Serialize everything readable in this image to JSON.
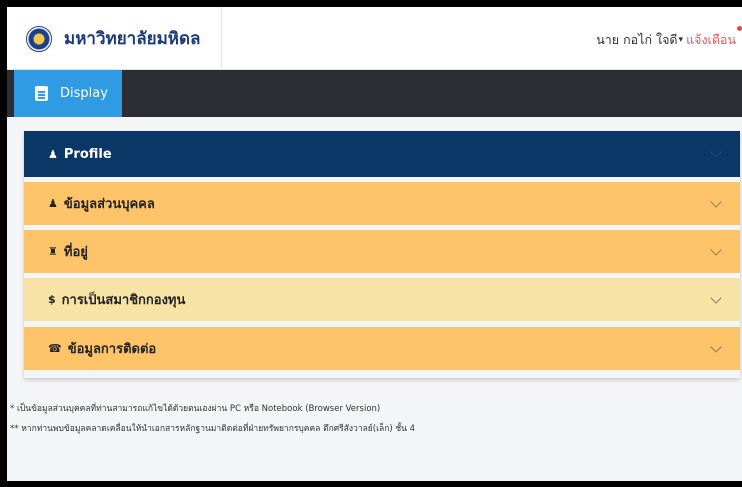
{
  "brand": {
    "name": "มหาวิทยาลัยมหิดล",
    "logo_icon": "university-seal-icon"
  },
  "user": {
    "name": "นาย กอไก่ ใจดี",
    "caret": "▾",
    "notifications_label": "แจ้งเตือน"
  },
  "nav": {
    "tab_label": "Display",
    "tab_icon": "clipboard-icon"
  },
  "accordion": {
    "header": {
      "icon": "♟",
      "label": "Profile"
    },
    "items": [
      {
        "icon": "♟",
        "label": "ข้อมูลส่วนบุคคล",
        "color": "#fec46a"
      },
      {
        "icon": "♜",
        "label": "ที่อยู่",
        "color": "#fec46a"
      },
      {
        "icon": "$",
        "label": "การเป็นสมาชิกกองทุน",
        "color": "#f7e3a6"
      },
      {
        "icon": "☎",
        "label": "ข้อมูลการติดต่อ",
        "color": "#fec46a"
      }
    ]
  },
  "notes": [
    "* เป็นข้อมูลส่วนบุคคลที่ท่านสามารถแก้ไขได้ด้วยตนเองผ่าน PC หรือ Notebook (Browser Version)",
    "** หากท่านพบข้อมูลคลาดเคลื่อนให้นำเอกสารหลักฐานมาติดต่อที่ฝ่ายทรัพยากรบุคคล ตึกศรีสังวาลย์(เล็ก) ชั้น 4"
  ],
  "colors": {
    "navy": "#0b3766",
    "accent_blue": "#2f9be3",
    "orange": "#fec46a",
    "pale_yellow": "#f7e3a6",
    "alert_red": "#e05a5a"
  }
}
